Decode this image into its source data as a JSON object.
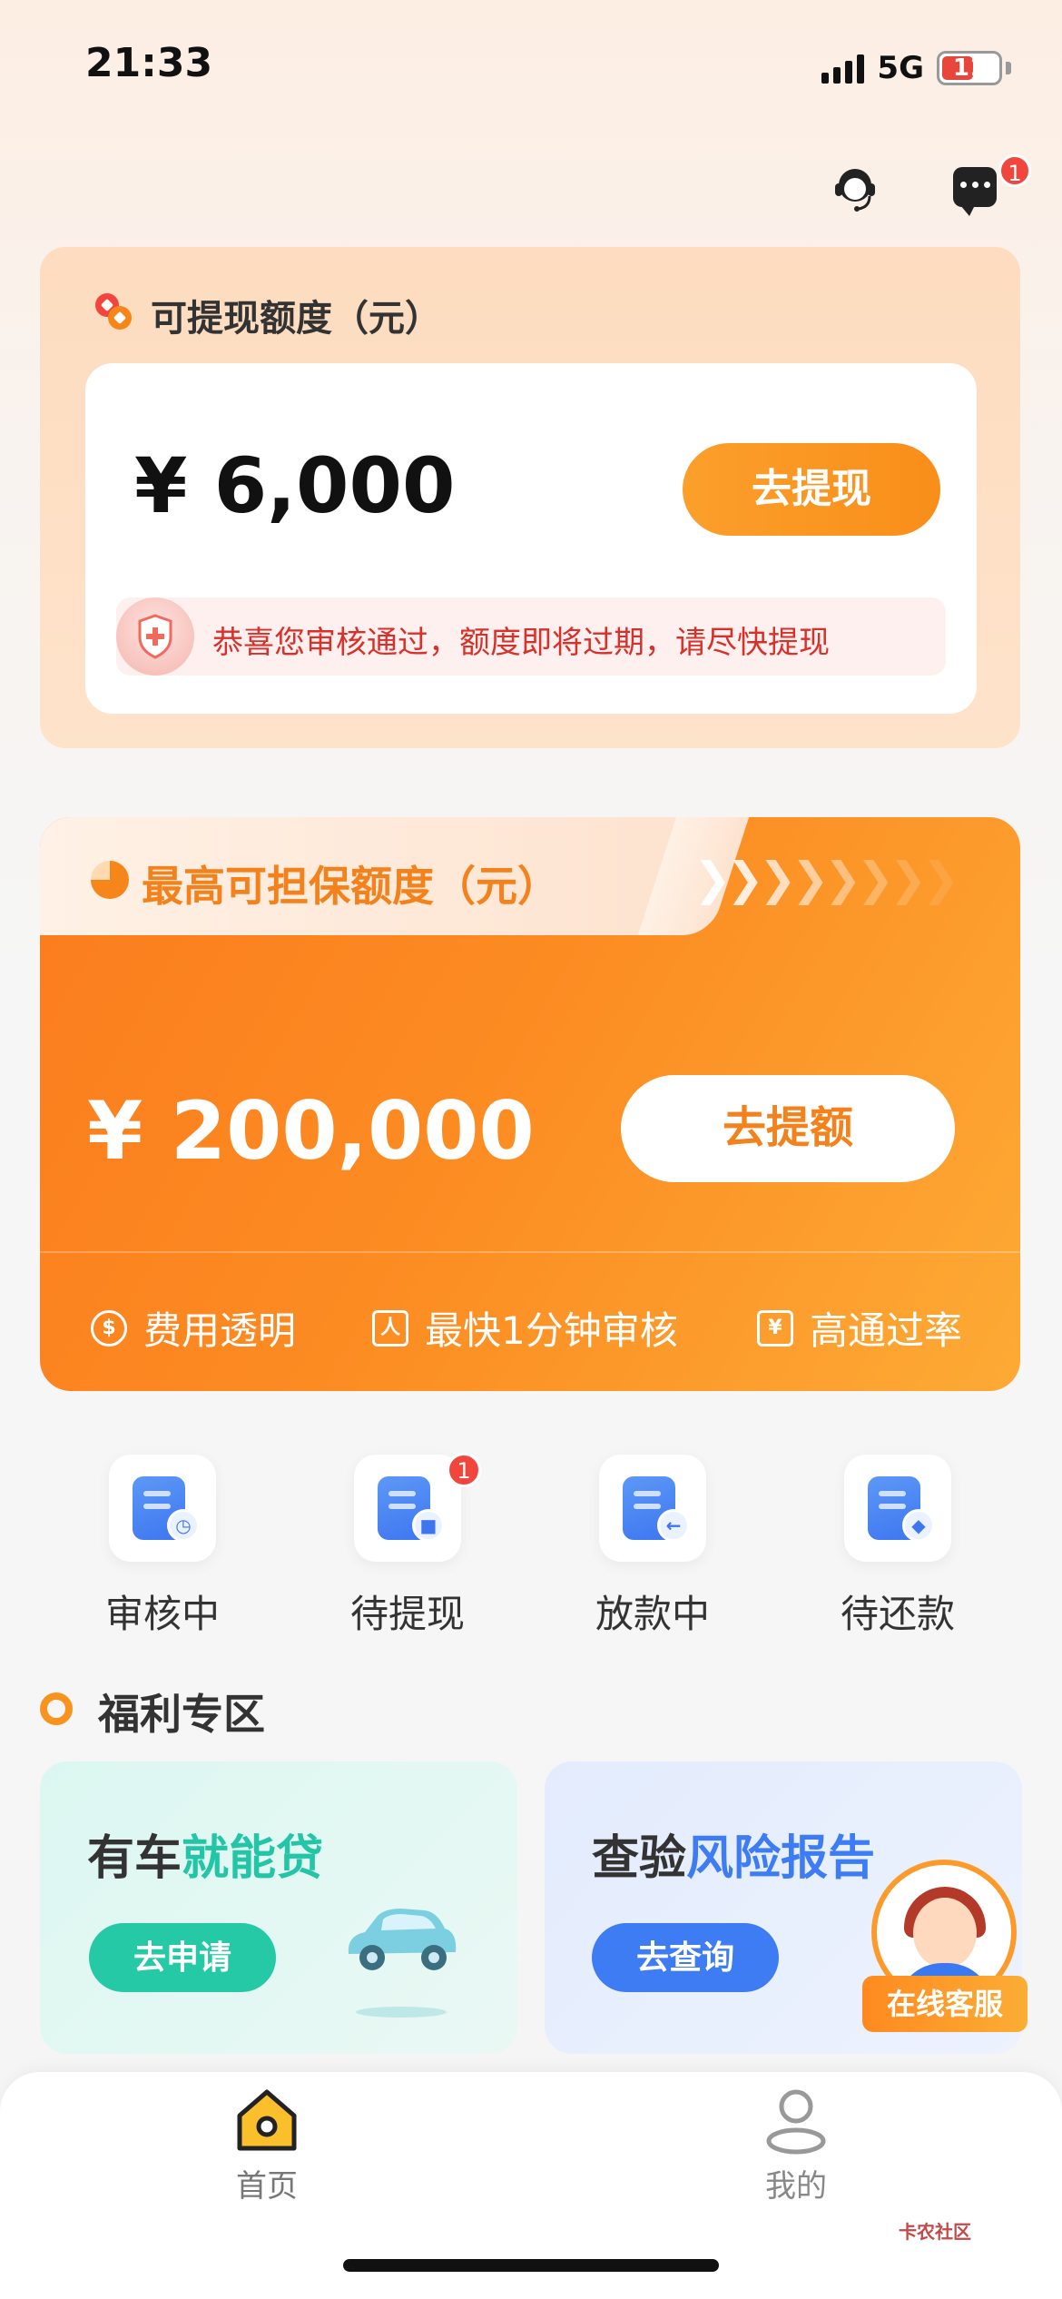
{
  "status_bar": {
    "time": "21:33",
    "network": "5G",
    "battery": "11"
  },
  "header": {
    "message_badge": "1"
  },
  "withdraw_card": {
    "title": "可提现额度（元）",
    "amount": "¥ 6,000",
    "button": "去提现",
    "notice": "恭喜您审核通过，额度即将过期，请尽快提现"
  },
  "guarantee_card": {
    "title": "最高可担保额度（元）",
    "amount": "¥ 200,000",
    "button": "去提额",
    "features": [
      {
        "icon": "$",
        "label": "费用透明"
      },
      {
        "icon": "人",
        "label": "最快1分钟审核"
      },
      {
        "icon": "¥",
        "label": "高通过率"
      }
    ]
  },
  "status_items": [
    {
      "label": "审核中",
      "mark": "◷"
    },
    {
      "label": "待提现",
      "mark": "■",
      "badge": "1"
    },
    {
      "label": "放款中",
      "mark": "←"
    },
    {
      "label": "待还款",
      "mark": "◆"
    }
  ],
  "welfare": {
    "title": "福利专区",
    "left": {
      "title_a": "有车",
      "title_b": "就能贷",
      "button": "去申请"
    },
    "right": {
      "title_a": "查验",
      "title_b": "风险报告",
      "button": "去查询"
    }
  },
  "floating_service": {
    "label": "在线客服"
  },
  "tabbar": {
    "home": "首页",
    "me": "我的"
  },
  "watermark": "卡农社区",
  "colors": {
    "orange": "#fb8a22",
    "green": "#22c5a6",
    "blue": "#3d7cf5",
    "red": "#f2453c"
  }
}
